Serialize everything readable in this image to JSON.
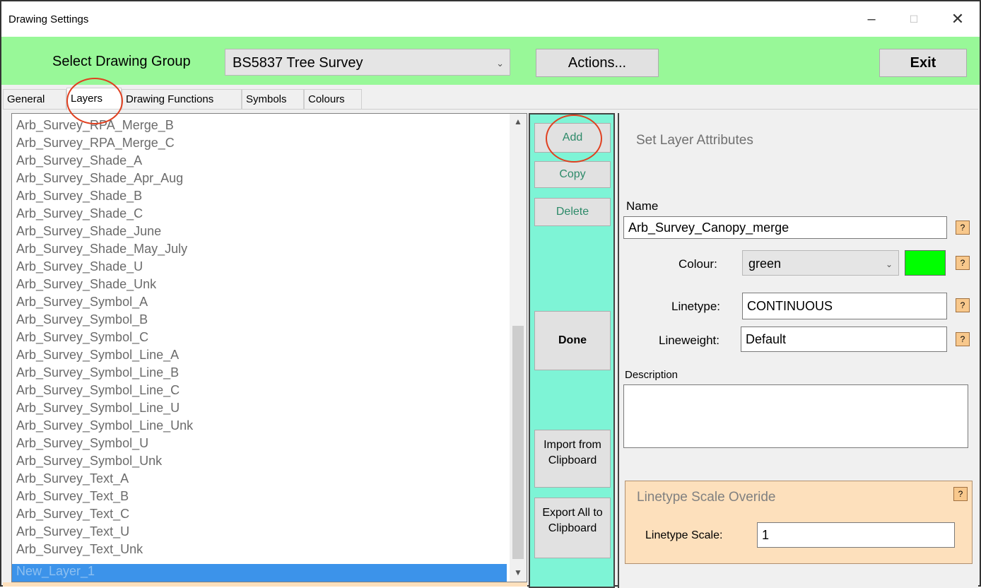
{
  "window": {
    "title": "Drawing Settings",
    "controls": {
      "minimize": "–",
      "maximize": "☐",
      "close": "✕"
    }
  },
  "toolbar": {
    "group_label": "Select Drawing Group",
    "group_value": "BS5837 Tree Survey",
    "actions_label": "Actions...",
    "exit_label": "Exit",
    "background_color": "#98f898"
  },
  "tabs": [
    {
      "label": "General",
      "active": false
    },
    {
      "label": "Layers",
      "active": true
    },
    {
      "label": "Drawing Functions",
      "active": false
    },
    {
      "label": "Symbols",
      "active": false
    },
    {
      "label": "Colours",
      "active": false
    }
  ],
  "layers": {
    "items": [
      "Arb_Survey_RPA_Merge_B",
      "Arb_Survey_RPA_Merge_C",
      "Arb_Survey_Shade_A",
      "Arb_Survey_Shade_Apr_Aug",
      "Arb_Survey_Shade_B",
      "Arb_Survey_Shade_C",
      "Arb_Survey_Shade_June",
      "Arb_Survey_Shade_May_July",
      "Arb_Survey_Shade_U",
      "Arb_Survey_Shade_Unk",
      "Arb_Survey_Symbol_A",
      "Arb_Survey_Symbol_B",
      "Arb_Survey_Symbol_C",
      "Arb_Survey_Symbol_Line_A",
      "Arb_Survey_Symbol_Line_B",
      "Arb_Survey_Symbol_Line_C",
      "Arb_Survey_Symbol_Line_U",
      "Arb_Survey_Symbol_Line_Unk",
      "Arb_Survey_Symbol_U",
      "Arb_Survey_Symbol_Unk",
      "Arb_Survey_Text_A",
      "Arb_Survey_Text_B",
      "Arb_Survey_Text_C",
      "Arb_Survey_Text_U",
      "Arb_Survey_Text_Unk",
      "New_Layer_1"
    ],
    "selected": "New_Layer_1"
  },
  "actions": {
    "add": "Add",
    "copy": "Copy",
    "delete": "Delete",
    "done": "Done",
    "import": "Import from Clipboard",
    "export": "Export All to Clipboard",
    "panel_color": "#7ef4d6"
  },
  "attributes": {
    "section_title": "Set Layer Attributes",
    "name_label": "Name",
    "name_value": "Arb_Survey_Canopy_merge",
    "colour_label": "Colour:",
    "colour_value": "green",
    "colour_swatch": "#00ff00",
    "linetype_label": "Linetype:",
    "linetype_value": "CONTINUOUS",
    "lineweight_label": "Lineweight:",
    "lineweight_value": "Default",
    "description_label": "Description",
    "description_value": "",
    "help": "?"
  },
  "linetype_scale": {
    "title": "Linetype Scale Overide",
    "label": "Linetype Scale:",
    "value": "1",
    "panel_color": "#fde0bc"
  }
}
